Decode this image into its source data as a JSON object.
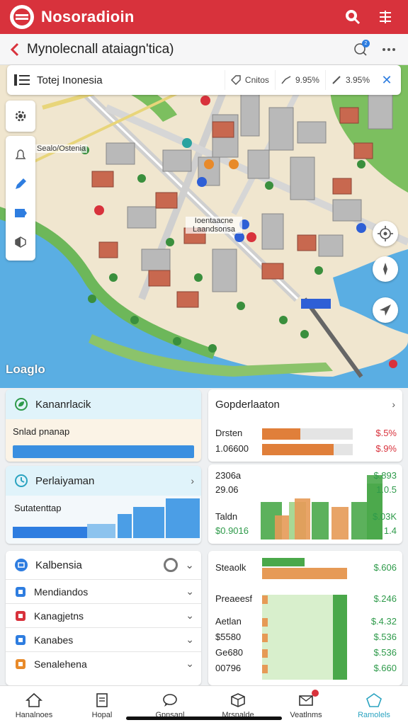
{
  "header": {
    "title": "Nosoradioin"
  },
  "subbar": {
    "title": "Mynolecnall ataiagn'tica)",
    "badge": "2"
  },
  "map": {
    "search_text": "Totej Inonesia",
    "chip1": "Cnitos",
    "chip2": "9.95%",
    "chip3": "3.95%",
    "label_area": "Sealo/Ostenia",
    "label_center": "Ioentaacne\nLaandsonsa",
    "brand": "Loaglo"
  },
  "cards": {
    "card1": {
      "title": "Kananrlacik",
      "label": "Snlad pnanap",
      "progress": 1.0
    },
    "card2": {
      "title": "Perlaiyaman",
      "label": "Sutatenttap",
      "bars": [
        0.28,
        0.35,
        0.6,
        0.78,
        1.0
      ]
    },
    "card3": {
      "title": "Kalbensia",
      "items": [
        {
          "label": "Mendiandos",
          "icon": "building-icon"
        },
        {
          "label": "Kanagjetns",
          "icon": "heart-icon"
        },
        {
          "label": "Kanabes",
          "icon": "location-icon"
        },
        {
          "label": "Senalehena",
          "icon": "chart-icon"
        }
      ]
    },
    "right1": {
      "title": "Gopderlaaton",
      "rows": [
        {
          "label": "Drsten",
          "value": "$.5%",
          "bar": 0.42,
          "color": "#e07f3a"
        },
        {
          "label": "1.06600",
          "value": "$.9%",
          "bar": 0.79,
          "color": "#e07f3a"
        }
      ]
    },
    "right2": {
      "labels": [
        "2306a",
        "29.06",
        "Taldn",
        "$0.9016"
      ],
      "values": [
        "$.893",
        "1.0.5",
        "$.03K",
        "1.4"
      ],
      "bars": [
        0.55,
        0.35,
        0.55,
        0.6,
        0.55,
        0.48,
        0.55,
        0.82,
        0.95
      ]
    },
    "right3": {
      "title": "Steaolk",
      "value": "$.606",
      "rows": [
        {
          "label": "Preaeesf",
          "value": "$.246"
        },
        {
          "label": "Aetlan",
          "value": "$.4.32"
        },
        {
          "label": "$5580",
          "value": "$.536"
        },
        {
          "label": "Ge680",
          "value": "$.536"
        },
        {
          "label": "00796",
          "value": "$.660"
        }
      ]
    }
  },
  "nav": {
    "items": [
      {
        "label": "Hanalnoes",
        "icon": "home-icon"
      },
      {
        "label": "Hopal",
        "icon": "document-icon"
      },
      {
        "label": "Gpnsanl",
        "icon": "chat-icon"
      },
      {
        "label": "Mrsnalde",
        "icon": "cube-icon"
      },
      {
        "label": "Veatlnms",
        "icon": "mail-icon"
      },
      {
        "label": "Ramolels",
        "icon": "shape-icon"
      }
    ]
  }
}
